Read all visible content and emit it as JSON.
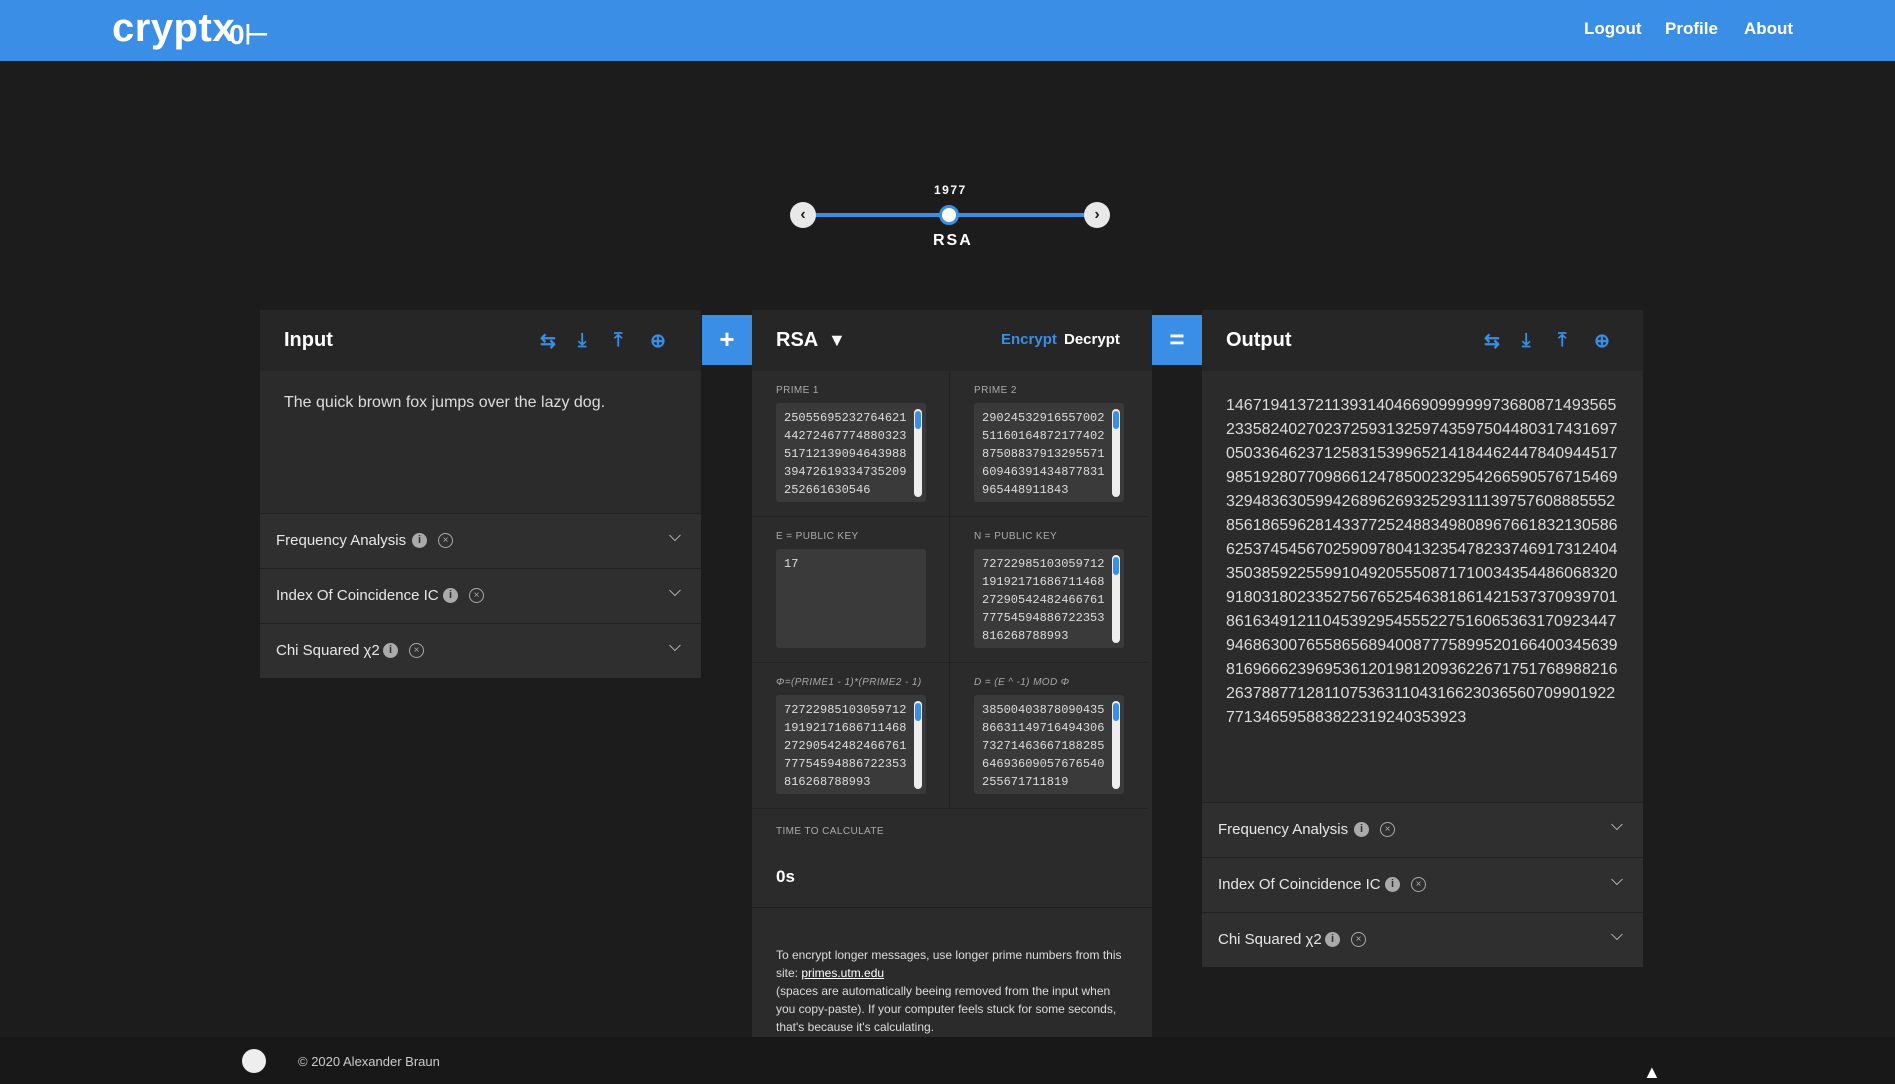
{
  "app": {
    "brand": "cryptx",
    "brand_icon": "key-icon"
  },
  "nav": {
    "logout": "Logout",
    "profile": "Profile",
    "about": "About"
  },
  "timeline": {
    "year": "1977",
    "name": "RSA"
  },
  "input_panel": {
    "title": "Input",
    "text": "The quick brown fox jumps over the lazy dog.",
    "accordions": [
      "Frequency Analysis",
      "Index Of Coincidence IC",
      "Chi Squared χ2"
    ]
  },
  "plus_button": "+",
  "equals_button": "=",
  "cipher": {
    "name": "RSA",
    "encrypt": "Encrypt",
    "decrypt": "Decrypt",
    "prime1_label": "PRIME 1",
    "prime1_value": "25055695232764621442724677748803235171213909464398839472619334735209252661630546",
    "prime2_label": "PRIME 2",
    "prime2_value": "29024532916557002511601648721774028750883791329557160946391434877831965448911843",
    "e_label": "E = PUBLIC KEY",
    "e_value": "17",
    "n_label": "N = PUBLIC KEY",
    "n_value": "72722985103059712191921716867114682729054248246676177754594886722353816268788993",
    "phi_label": "Φ=(PRIME1 - 1)*(PRIME2 - 1)",
    "phi_value": "72722985103059712191921716867114682729054248246676177754594886722353816268788993",
    "d_label": "D = (E ^ -1) MOD Φ",
    "d_value": "38500403878090435866311497164943067327146366718828564693609057676540255671711819",
    "ttc_label": "TIME TO CALCULATE",
    "ttc_value": "0s",
    "note_1": "To encrypt longer messages, use longer prime numbers from this site: ",
    "note_link": "primes.utm.edu",
    "note_2": "(spaces are automatically beeing removed from the input when you copy-paste). If your computer feels stuck for some seconds, that's because it's calculating."
  },
  "output_panel": {
    "title": "Output",
    "text": "1467194137211393140466909999997368087149356523358240270237259313259743597504480317431697050336462371258315399652141844624478409445179851928077098661247850023295426659057671546932948363059942689626932529311139757608885552856186596281433772524883498089676618321305866253745456702590978041323547823374691731240435038592255991049205550871710034354486068320918031802335275676525463818614215373709397018616349121104539295455522751606536317092344794686300765586568940087775899520166400345639816966623969536120198120936226717517689882162637887712811075363110431662303656070990192277134659588382231924035392​3",
    "accordions": [
      "Frequency Analysis",
      "Index Of Coincidence IC",
      "Chi Squared χ2"
    ]
  },
  "footer": {
    "copyright": "© 2020 Alexander Braun",
    "github_icon": "github-icon"
  },
  "colors": {
    "accent": "#3a8ee6",
    "background": "#1c1c1c",
    "panel": "#2b2b2b"
  }
}
